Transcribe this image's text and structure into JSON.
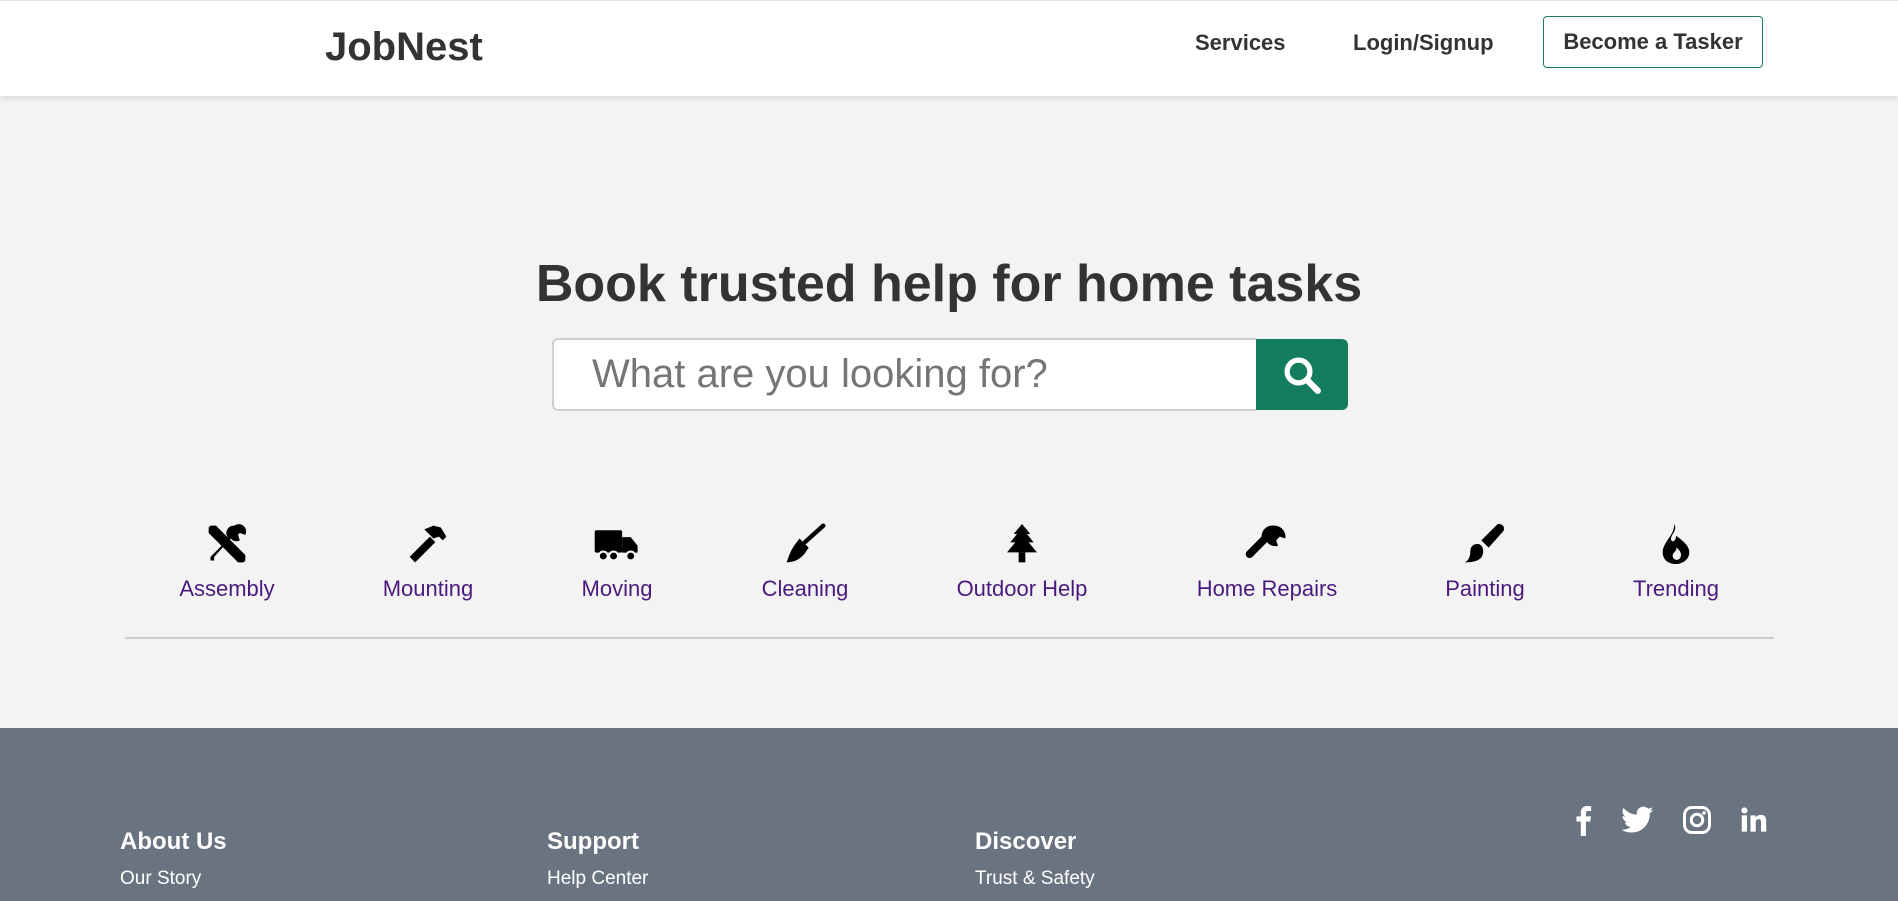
{
  "header": {
    "logo": "JobNest",
    "nav": {
      "services": "Services",
      "login": "Login/Signup"
    },
    "cta": "Become a Tasker"
  },
  "hero": {
    "title": "Book trusted help for home tasks",
    "search": {
      "placeholder": "What are you looking for?",
      "value": "",
      "icon": "search-icon"
    }
  },
  "categories": [
    {
      "label": "Assembly",
      "icon": "tools-icon"
    },
    {
      "label": "Mounting",
      "icon": "hammer-icon"
    },
    {
      "label": "Moving",
      "icon": "truck-icon"
    },
    {
      "label": "Cleaning",
      "icon": "broom-icon"
    },
    {
      "label": "Outdoor Help",
      "icon": "tree-icon"
    },
    {
      "label": "Home Repairs",
      "icon": "wrench-icon"
    },
    {
      "label": "Painting",
      "icon": "paintbrush-icon"
    },
    {
      "label": "Trending",
      "icon": "fire-icon"
    }
  ],
  "footer": {
    "columns": [
      {
        "heading": "About Us",
        "links": [
          "Our Story"
        ]
      },
      {
        "heading": "Support",
        "links": [
          "Help Center"
        ]
      },
      {
        "heading": "Discover",
        "links": [
          "Trust & Safety"
        ]
      }
    ],
    "social": [
      "facebook-icon",
      "twitter-icon",
      "instagram-icon",
      "linkedin-icon"
    ]
  },
  "colors": {
    "accent": "#137d5e",
    "category_text": "#4b1a7d",
    "footer_bg": "#6a7380",
    "page_bg": "#f3f3f3"
  }
}
